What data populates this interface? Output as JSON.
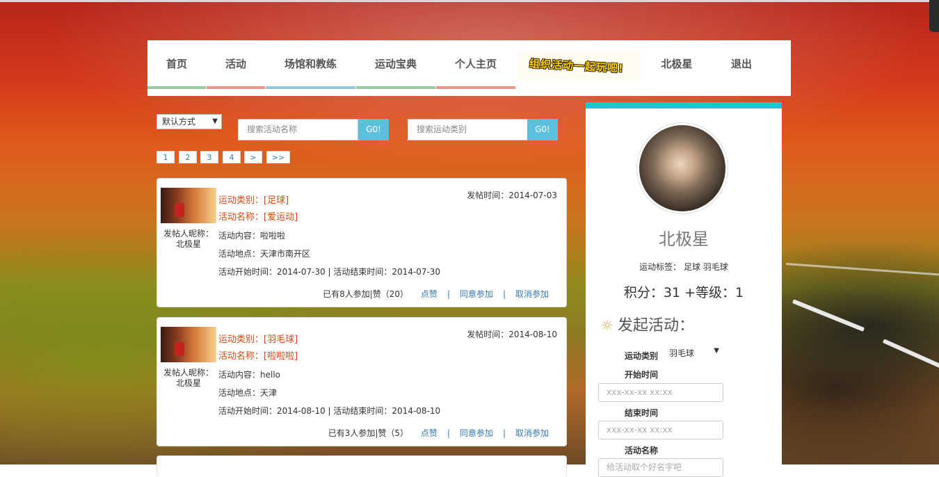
{
  "nav": {
    "items": [
      {
        "label": "首页",
        "line": "#9ccb9a"
      },
      {
        "label": "活动",
        "line": "#f0938a"
      },
      {
        "label": "场馆和教练",
        "line": "#8fc9dd"
      },
      {
        "label": "运动宝典",
        "line": "#9ccb9a"
      },
      {
        "label": "个人主页",
        "line": "#f0938a"
      }
    ],
    "promo": "组织活动一起玩吧!",
    "user": "北极星",
    "logout": "退出"
  },
  "filters": {
    "sort_value": "默认方式",
    "search_name_placeholder": "搜索活动名称",
    "search_type_placeholder": "搜索运动类别",
    "go_label": "G0!"
  },
  "pager": [
    "1",
    "2",
    "3",
    "4",
    ">",
    ">>"
  ],
  "posts": [
    {
      "category": "运动类别：[足球]",
      "name": "活动名称：[爱运动]",
      "poster_label": "发帖人昵称：",
      "poster": "北极星",
      "date_label": "发帖时间：",
      "date": "2014-07-03",
      "content": "活动内容：啦啦啦",
      "location": "活动地点：天津市南开区",
      "time": "活动开始时间：2014-07-30 | 活动结束时间：2014-07-30",
      "joined": "已有8人参加|赞（20）",
      "like": "点赞",
      "agree": "同意参加",
      "cancel": "取消参加"
    },
    {
      "category": "运动类别：[羽毛球]",
      "name": "活动名称：[啦啦啦]",
      "poster_label": "发帖人昵称：",
      "poster": "北极星",
      "date_label": "发帖时间：",
      "date": "2014-08-10",
      "content": "活动内容：hello",
      "location": "活动地点：天津",
      "time": "活动开始时间：2014-08-10 | 活动结束时间：2014-08-10",
      "joined": "已有3人参加|赞（5）",
      "like": "点赞",
      "agree": "同意参加",
      "cancel": "取消参加"
    }
  ],
  "profile": {
    "name": "北极星",
    "tags": "运动标签： 足球 羽毛球",
    "score": "积分：31 +等级：1",
    "launch_title": "发起活动：",
    "form": {
      "type_label": "运动类别",
      "type_value": "羽毛球",
      "start_label": "开始时间",
      "start_placeholder": "xxx-xx-xx xx:xx",
      "end_label": "结束时间",
      "end_placeholder": "xxx-xx-xx xx:xx",
      "name_label": "活动名称",
      "name_placeholder": "给活动取个好名字吧"
    }
  },
  "colors": {
    "accent": "#1bc4d6",
    "go": "#5bc0de",
    "highlight": "#d9480f",
    "link": "#337ab7"
  }
}
